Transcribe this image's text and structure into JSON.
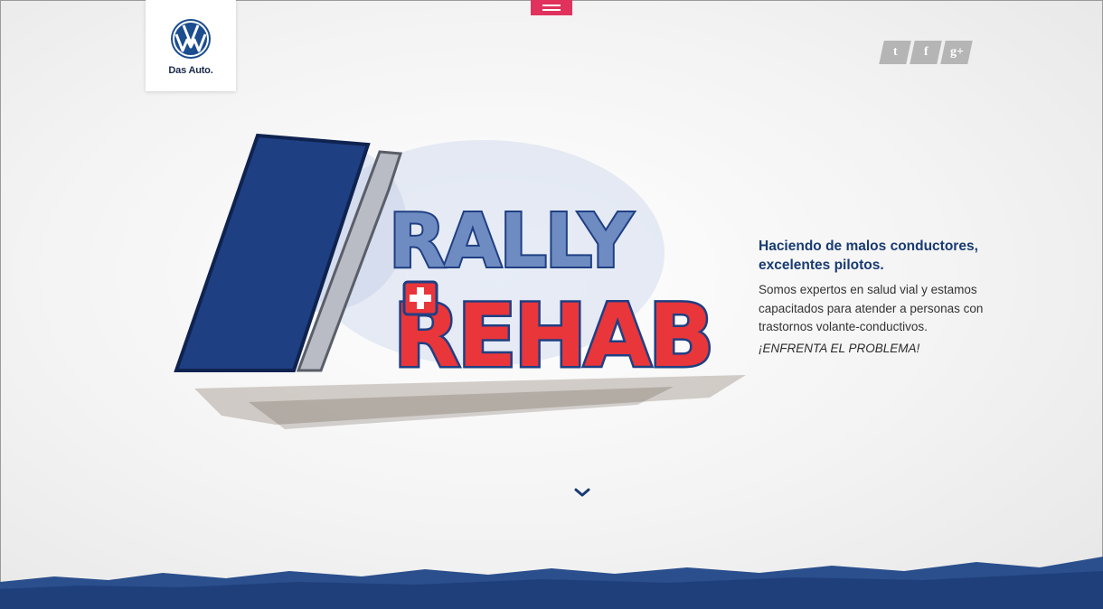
{
  "brand": {
    "tagline": "Das Auto."
  },
  "social": {
    "twitter_glyph": "t",
    "facebook_glyph": "f",
    "googleplus_glyph": "g+"
  },
  "hero": {
    "title_line1": "RALLY",
    "title_line2": "REHAB",
    "colors": {
      "blue": "#1f3f83",
      "red": "#e8363b",
      "slate": "#5f7bb0"
    }
  },
  "copy": {
    "headline_line1": "Haciendo de malos conductores,",
    "headline_line2": "excelentes pilotos.",
    "body_line1": "Somos expertos en salud vial y estamos",
    "body_line2": "capacitados para atender a personas con",
    "body_line3": "trastornos volante-conductivos.",
    "cta": "¡ENFRENTA EL PROBLEMA!"
  },
  "icons": {
    "menu": "hamburger-icon",
    "scroll": "chevron-down-icon"
  },
  "theme": {
    "accent_pink": "#e0325c",
    "navy": "#183b73",
    "brush_blue": "#2a4f8c"
  }
}
